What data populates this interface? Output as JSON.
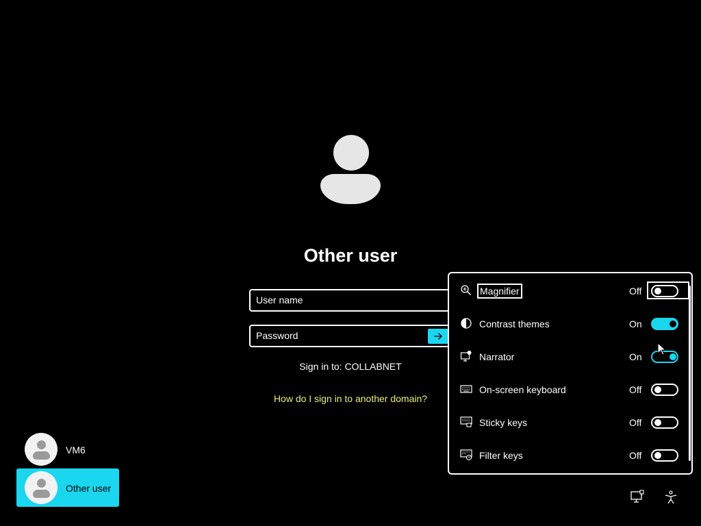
{
  "login": {
    "title": "Other user",
    "username_placeholder": "User name",
    "password_placeholder": "Password",
    "sign_in_to": "Sign in to: COLLABNET",
    "domain_link": "How do I sign in to another domain?"
  },
  "users": [
    {
      "name": "VM6",
      "selected": false
    },
    {
      "name": "Other user",
      "selected": true
    }
  ],
  "accessibility": {
    "items": [
      {
        "label": "Magnifier",
        "state": "Off",
        "icon": "magnifier-icon"
      },
      {
        "label": "Contrast themes",
        "state": "On",
        "icon": "contrast-icon"
      },
      {
        "label": "Narrator",
        "state": "On",
        "icon": "narrator-icon"
      },
      {
        "label": "On-screen keyboard",
        "state": "Off",
        "icon": "keyboard-icon"
      },
      {
        "label": "Sticky keys",
        "state": "Off",
        "icon": "sticky-keys-icon"
      },
      {
        "label": "Filter keys",
        "state": "Off",
        "icon": "filter-keys-icon"
      }
    ]
  },
  "tray": {
    "network_icon": "network-icon",
    "accessibility_icon": "accessibility-icon"
  },
  "colors": {
    "accent": "#1ad7ef",
    "link": "#e8f07a",
    "background": "#000000"
  }
}
